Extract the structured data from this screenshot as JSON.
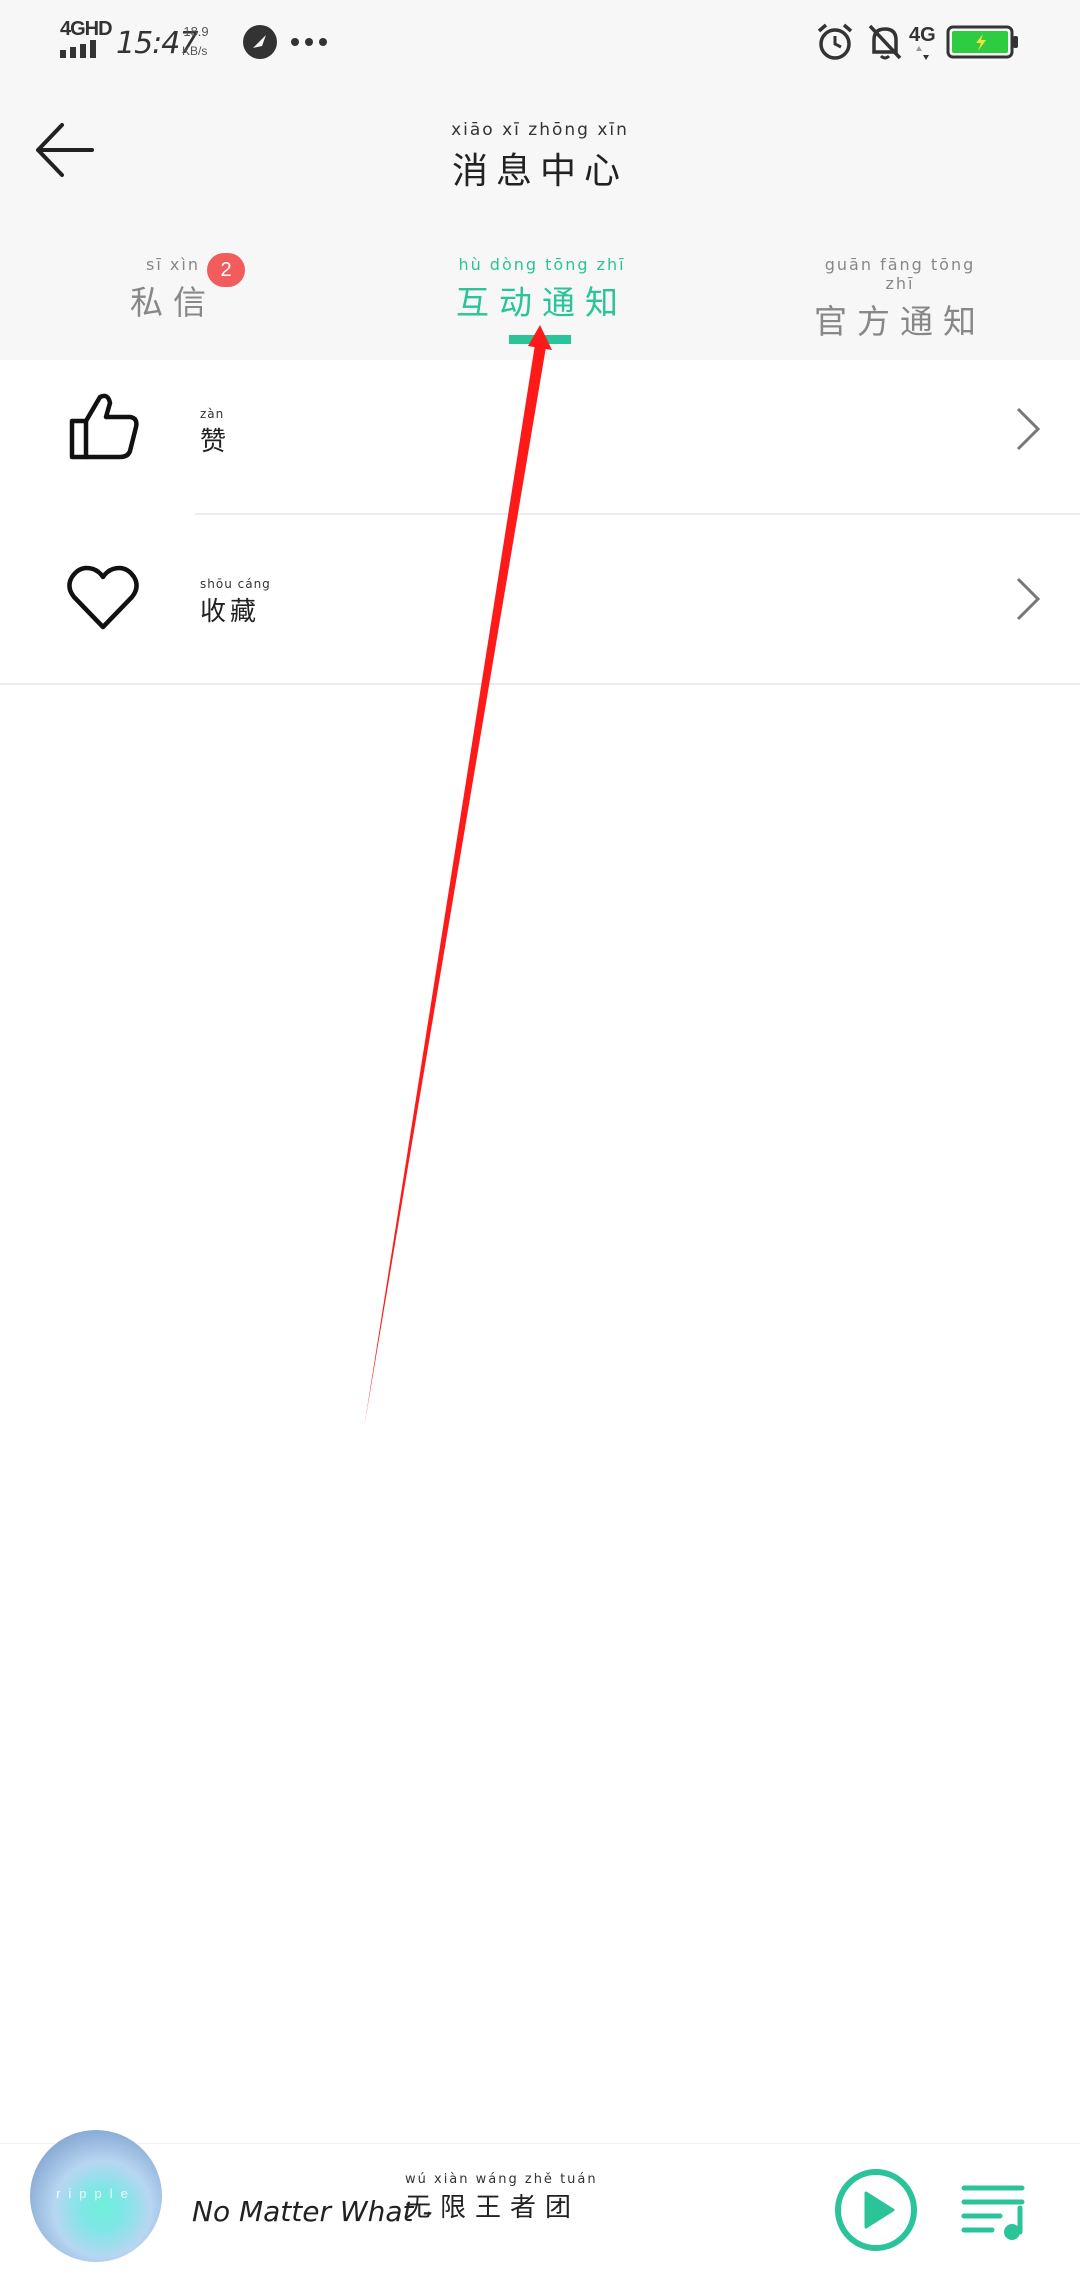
{
  "status_bar": {
    "network_label": "4GHD",
    "time": "15:47",
    "speed_value": "18.9",
    "speed_unit": "KB/s",
    "mobile_data_label": "4G",
    "battery_color": "#2ecc40"
  },
  "header": {
    "title_pinyin": "xiāo xī zhōng xīn",
    "title": "消息中心",
    "back_icon": "arrow-left-icon"
  },
  "tabs": [
    {
      "pinyin": "sī xìn",
      "label": "私信",
      "badge": "2",
      "active": false
    },
    {
      "pinyin": "hù dòng tōng zhī",
      "label": "互动通知",
      "active": true
    },
    {
      "pinyin": "guān fāng tōng zhī",
      "label": "官方通知",
      "active": false
    }
  ],
  "accent_color": "#2ac39a",
  "badge_color": "#f25c5c",
  "list": [
    {
      "icon": "thumbs-up-icon",
      "pinyin": "zàn",
      "label": "赞"
    },
    {
      "icon": "heart-icon",
      "pinyin": "shōu cáng",
      "label": "收藏"
    }
  ],
  "annotation_color": "#ff1a1a",
  "player": {
    "album_text": "ripple",
    "title": "No Matter What -",
    "artist_pinyin": "wú xiàn wáng zhě tuán",
    "artist": "无限王者团"
  }
}
